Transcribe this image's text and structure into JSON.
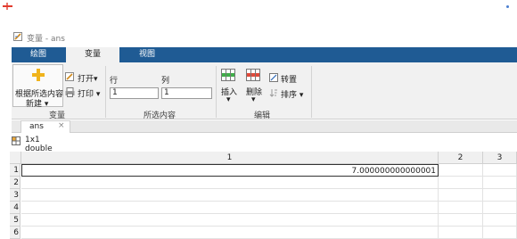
{
  "window": {
    "title": "变量 - ans"
  },
  "tabs": [
    {
      "label": "绘图"
    },
    {
      "label": "变量"
    },
    {
      "label": "视图"
    }
  ],
  "ribbon": {
    "new_from_selection_label": "根据所选内容",
    "new_label": "新建 ▾",
    "open_label": "打开▾",
    "print_label": "打印 ▾",
    "group_variable_label": "变量",
    "row_label": "行",
    "col_label": "列",
    "row_value": "1",
    "col_value": "1",
    "group_selection_label": "所选内容",
    "insert_label": "插入",
    "delete_label": "删除",
    "transpose_label": "转置",
    "sort_label": "排序 ▾",
    "group_edit_label": "编辑",
    "insert_arrow": "▾",
    "delete_arrow": "▾"
  },
  "document": {
    "tab_name": "ans",
    "close_glyph": "×",
    "info": "1x1 double"
  },
  "grid": {
    "columns": [
      "1",
      "2",
      "3"
    ],
    "rows": [
      "1",
      "2",
      "3",
      "4",
      "5",
      "6"
    ],
    "value": "7.000000000000001"
  },
  "colors": {
    "tab_bar": "#1f5b94",
    "ribbon": "#f1f1f1"
  }
}
